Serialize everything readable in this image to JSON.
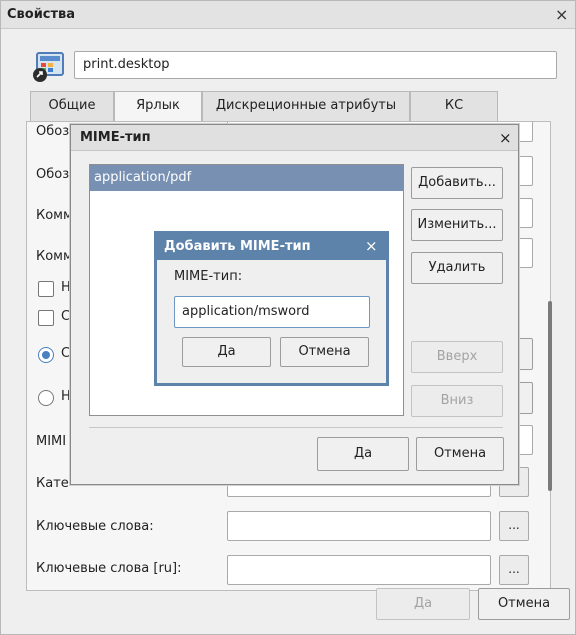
{
  "window": {
    "title": "Свойства",
    "close_glyph": "×"
  },
  "filename": "print.desktop",
  "tabs": [
    "Общие",
    "Ярлык",
    "Дискреционные атрибуты",
    "КС"
  ],
  "panel": {
    "rows_partial": [
      "Обоз",
      "Обоз",
      "Комм",
      "Комм"
    ],
    "checkbox_1": "Н",
    "checkbox_2": "С",
    "radio_1": "С",
    "radio_2": "Н",
    "mime_label_partial": "MIMI",
    "category_partial": "Кате",
    "keywords_label": "Ключевые слова:",
    "keywords_ru_label": "Ключевые слова [ru]:",
    "dots_label": "..."
  },
  "footer": {
    "ok": "Да",
    "cancel": "Отмена"
  },
  "mime_dialog": {
    "title": "MIME-тип",
    "close_glyph": "×",
    "selected_item": "application/pdf",
    "buttons": {
      "add": "Добавить...",
      "edit": "Изменить...",
      "delete": "Удалить",
      "up": "Вверх",
      "down": "Вниз"
    },
    "ok": "Да",
    "cancel": "Отмена"
  },
  "add_dialog": {
    "title": "Добавить MIME-тип",
    "close_glyph": "×",
    "label": "MIME-тип:",
    "value": "application/msword",
    "ok": "Да",
    "cancel": "Отмена"
  }
}
